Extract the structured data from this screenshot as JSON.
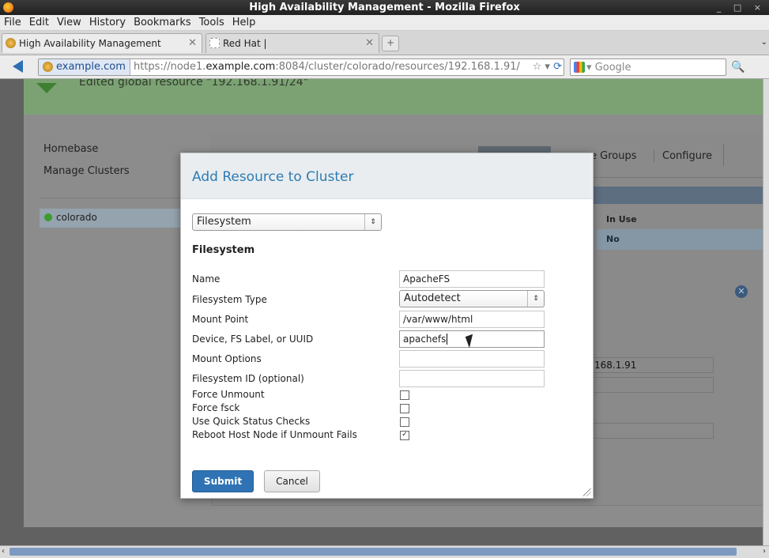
{
  "window": {
    "title": "High Availability Management - Mozilla Firefox",
    "controls": "_ □ ×"
  },
  "menubar": [
    "File",
    "Edit",
    "View",
    "History",
    "Bookmarks",
    "Tools",
    "Help"
  ],
  "tabs": [
    {
      "label": "High Availability Management"
    },
    {
      "label": "Red Hat |"
    }
  ],
  "new_tab_label": "+",
  "nav": {
    "identity": "example.com",
    "url_prefix": "https://node1.",
    "url_domain": "example.com",
    "url_suffix": ":8084/cluster/colorado/resources/192.168.1.91/",
    "search_placeholder": "Google"
  },
  "page": {
    "notice": "Edited global resource \"192.168.1.91/24\"",
    "left_nav": [
      "Homebase",
      "Manage Clusters"
    ],
    "cluster": "colorado",
    "tabs_visible": [
      "e Groups",
      "Configure"
    ],
    "in_use_header": "In Use",
    "in_use_value": "No",
    "ip_value": "168.1.91"
  },
  "modal": {
    "title": "Add Resource to Cluster",
    "resource_type": "Filesystem",
    "section_title": "Filesystem",
    "fields": {
      "name_label": "Name",
      "name_value": "ApacheFS",
      "fstype_label": "Filesystem Type",
      "fstype_value": "Autodetect",
      "mount_label": "Mount Point",
      "mount_value": "/var/www/html",
      "device_label": "Device, FS Label, or UUID",
      "device_value": "apachefs",
      "options_label": "Mount Options",
      "options_value": "",
      "fsid_label": "Filesystem ID (optional)",
      "fsid_value": ""
    },
    "checkboxes": [
      {
        "label": "Force Unmount",
        "checked": false
      },
      {
        "label": "Force fsck",
        "checked": false
      },
      {
        "label": "Use Quick Status Checks",
        "checked": false
      },
      {
        "label": "Reboot Host Node if Unmount Fails",
        "checked": true
      }
    ],
    "submit_label": "Submit",
    "cancel_label": "Cancel"
  }
}
